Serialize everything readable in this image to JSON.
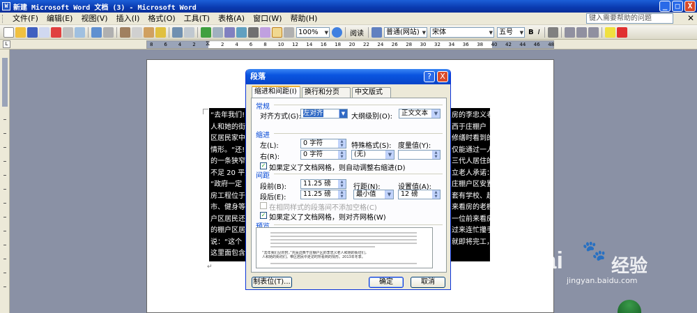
{
  "window": {
    "title": "新建 Microsoft Word 文档 (3) - Microsoft Word",
    "min": "_",
    "max": "□",
    "close": "X"
  },
  "menu": {
    "items": [
      "文件(F)",
      "编辑(E)",
      "视图(V)",
      "插入(I)",
      "格式(O)",
      "工具(T)",
      "表格(A)",
      "窗口(W)",
      "帮助(H)"
    ],
    "help_placeholder": "键入需要帮助的问题",
    "doc_close": "✕"
  },
  "toolbar": {
    "zoom": "100%",
    "read": "阅读",
    "style": "普通(网站)",
    "font": "宋体",
    "size": "五号",
    "bold": "B",
    "italic": "I"
  },
  "ruler": {
    "numbers": [
      "8",
      "6",
      "4",
      "2",
      "",
      "2",
      "4",
      "6",
      "8",
      "10",
      "12",
      "14",
      "16",
      "18",
      "20",
      "22",
      "24",
      "26",
      "28",
      "30",
      "32",
      "34",
      "36",
      "38",
      "40",
      "42",
      "44",
      "46",
      "48"
    ]
  },
  "document": {
    "lines": [
      "“去年我们!",
      "人和她的街坊",
      "区居民家中头",
      "情形。“还!",
      "的一条狭窄",
      "不足 20 平方",
      "“政府一定",
      "房工程位于",
      "市、健身等",
      "户区居民还",
      "的棚户区居",
      "说：“这个",
      "这里面包含"
    ],
    "right_lines": [
      "房的李忠义老",
      "西于庄棚户",
      "修缮时看到的",
      "仅能通过一人",
      "三代人居住的",
      "立老人承诺：",
      "庄棚户区安置",
      "套有学校、超",
      "来看房的老棚",
      "一位前来看房",
      "过来连忙攥手",
      "就即将完工，",
      ""
    ],
    "cursor": "↵"
  },
  "dialog": {
    "title": "段落",
    "help": "?",
    "close": "X",
    "tabs": [
      "缩进和间距(I)",
      "换行和分页(P)",
      "中文版式(H)"
    ],
    "general": {
      "header": "常规",
      "align_label": "对齐方式(G):",
      "align_value": "左对齐",
      "outline_label": "大纲级别(O):",
      "outline_value": "正文文本"
    },
    "indent": {
      "header": "缩进",
      "left_label": "左(L):",
      "left_value": "0 字符",
      "right_label": "右(R):",
      "right_value": "0 字符",
      "special_label": "特殊格式(S):",
      "special_value": "(无)",
      "by_label": "度量值(Y):",
      "by_value": "",
      "auto_adjust": "如果定义了文档网格，则自动调整右缩进(D)",
      "auto_adjust_checked": true
    },
    "spacing": {
      "header": "间距",
      "before_label": "段前(B):",
      "before_value": "11.25 磅",
      "after_label": "段后(E):",
      "after_value": "11.25 磅",
      "line_label": "行距(N):",
      "line_value": "最小值",
      "at_label": "设置值(A):",
      "at_value": "12 磅",
      "no_space": "在相同样式的段落间不添加空格(C)",
      "no_space_checked": false,
      "snap_grid": "如果定义了文档网格，则对齐网格(W)",
      "snap_grid_checked": true
    },
    "preview": {
      "header": "预览",
      "text1": "“去年我们见你时，”共采访西于庄棚户区的李忠义老人和她的街坊们，",
      "text2": "人和她的街坊们。带区居民中走访时所看到的情形。2013年冬季。"
    },
    "buttons": {
      "tabs": "制表位(T)...",
      "ok": "确定",
      "cancel": "取消"
    }
  },
  "watermark": {
    "brand": "Bai",
    "brand_cn": "经验",
    "url": "jingyan.baidu.com"
  },
  "colors": {
    "title_blue": "#0a3ab0",
    "dialog_frame": "#0831d9",
    "workspace": "#8a91a5"
  }
}
